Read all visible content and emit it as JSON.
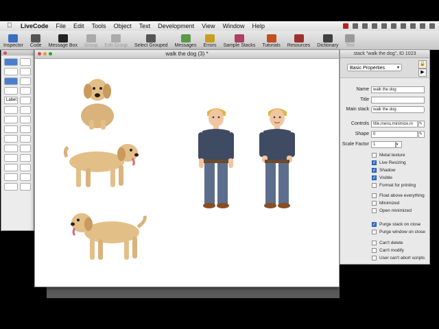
{
  "menubar": {
    "items": [
      "LiveCode",
      "File",
      "Edit",
      "Tools",
      "Object",
      "Text",
      "Development",
      "View",
      "Window",
      "Help"
    ]
  },
  "toolbar": {
    "items": [
      {
        "label": "Inspector",
        "color": "#3a6fc0"
      },
      {
        "label": "Code",
        "color": "#555555"
      },
      {
        "label": "Message Box",
        "color": "#222222"
      },
      {
        "label": "Group",
        "color": "#aaaaaa"
      },
      {
        "label": "Edit Group",
        "color": "#aaaaaa"
      },
      {
        "label": "Select Grouped",
        "color": "#555555"
      },
      {
        "label": "Messages",
        "color": "#5a9a4a"
      },
      {
        "label": "Errors",
        "color": "#c8a020"
      },
      {
        "label": "Sample Stacks",
        "color": "#b04060"
      },
      {
        "label": "Tutorials",
        "color": "#c05020"
      },
      {
        "label": "Resources",
        "color": "#a03030"
      },
      {
        "label": "Dictionary",
        "color": "#404040"
      },
      {
        "label": "Test",
        "color": "#9a9a9a"
      }
    ]
  },
  "palette": {
    "label_tool": "Label:"
  },
  "stack_window": {
    "title": "walk the dog (3) *"
  },
  "inspector": {
    "title": "stack \"walk the dog\", ID 1023",
    "section": "Basic Properties",
    "fields": {
      "name_label": "Name",
      "name_value": "walk the dog",
      "title_label": "Title",
      "title_value": "",
      "mainstack_label": "Main stack",
      "mainstack_value": "walk the dog",
      "controls_label": "Controls",
      "controls_value": "title,menu,minimize,m",
      "shape_label": "Shape",
      "shape_value": "0",
      "scale_label": "Scale Factor",
      "scale_value": "1"
    },
    "checks": [
      {
        "label": "Metal texture",
        "on": false
      },
      {
        "label": "Live Resizing",
        "on": true
      },
      {
        "label": "Shadow",
        "on": true
      },
      {
        "label": "Visible",
        "on": true
      },
      {
        "label": "Format for printing",
        "on": false
      },
      {
        "label": "Float above everything",
        "on": false
      },
      {
        "label": "Minimized",
        "on": false
      },
      {
        "label": "Open minimized",
        "on": false
      },
      {
        "label": "Purge stack on close",
        "on": true
      },
      {
        "label": "Purge window on close",
        "on": false
      },
      {
        "label": "Can't delete",
        "on": false
      },
      {
        "label": "Can't modify",
        "on": false
      },
      {
        "label": "User can't abort scripts",
        "on": false
      }
    ]
  }
}
